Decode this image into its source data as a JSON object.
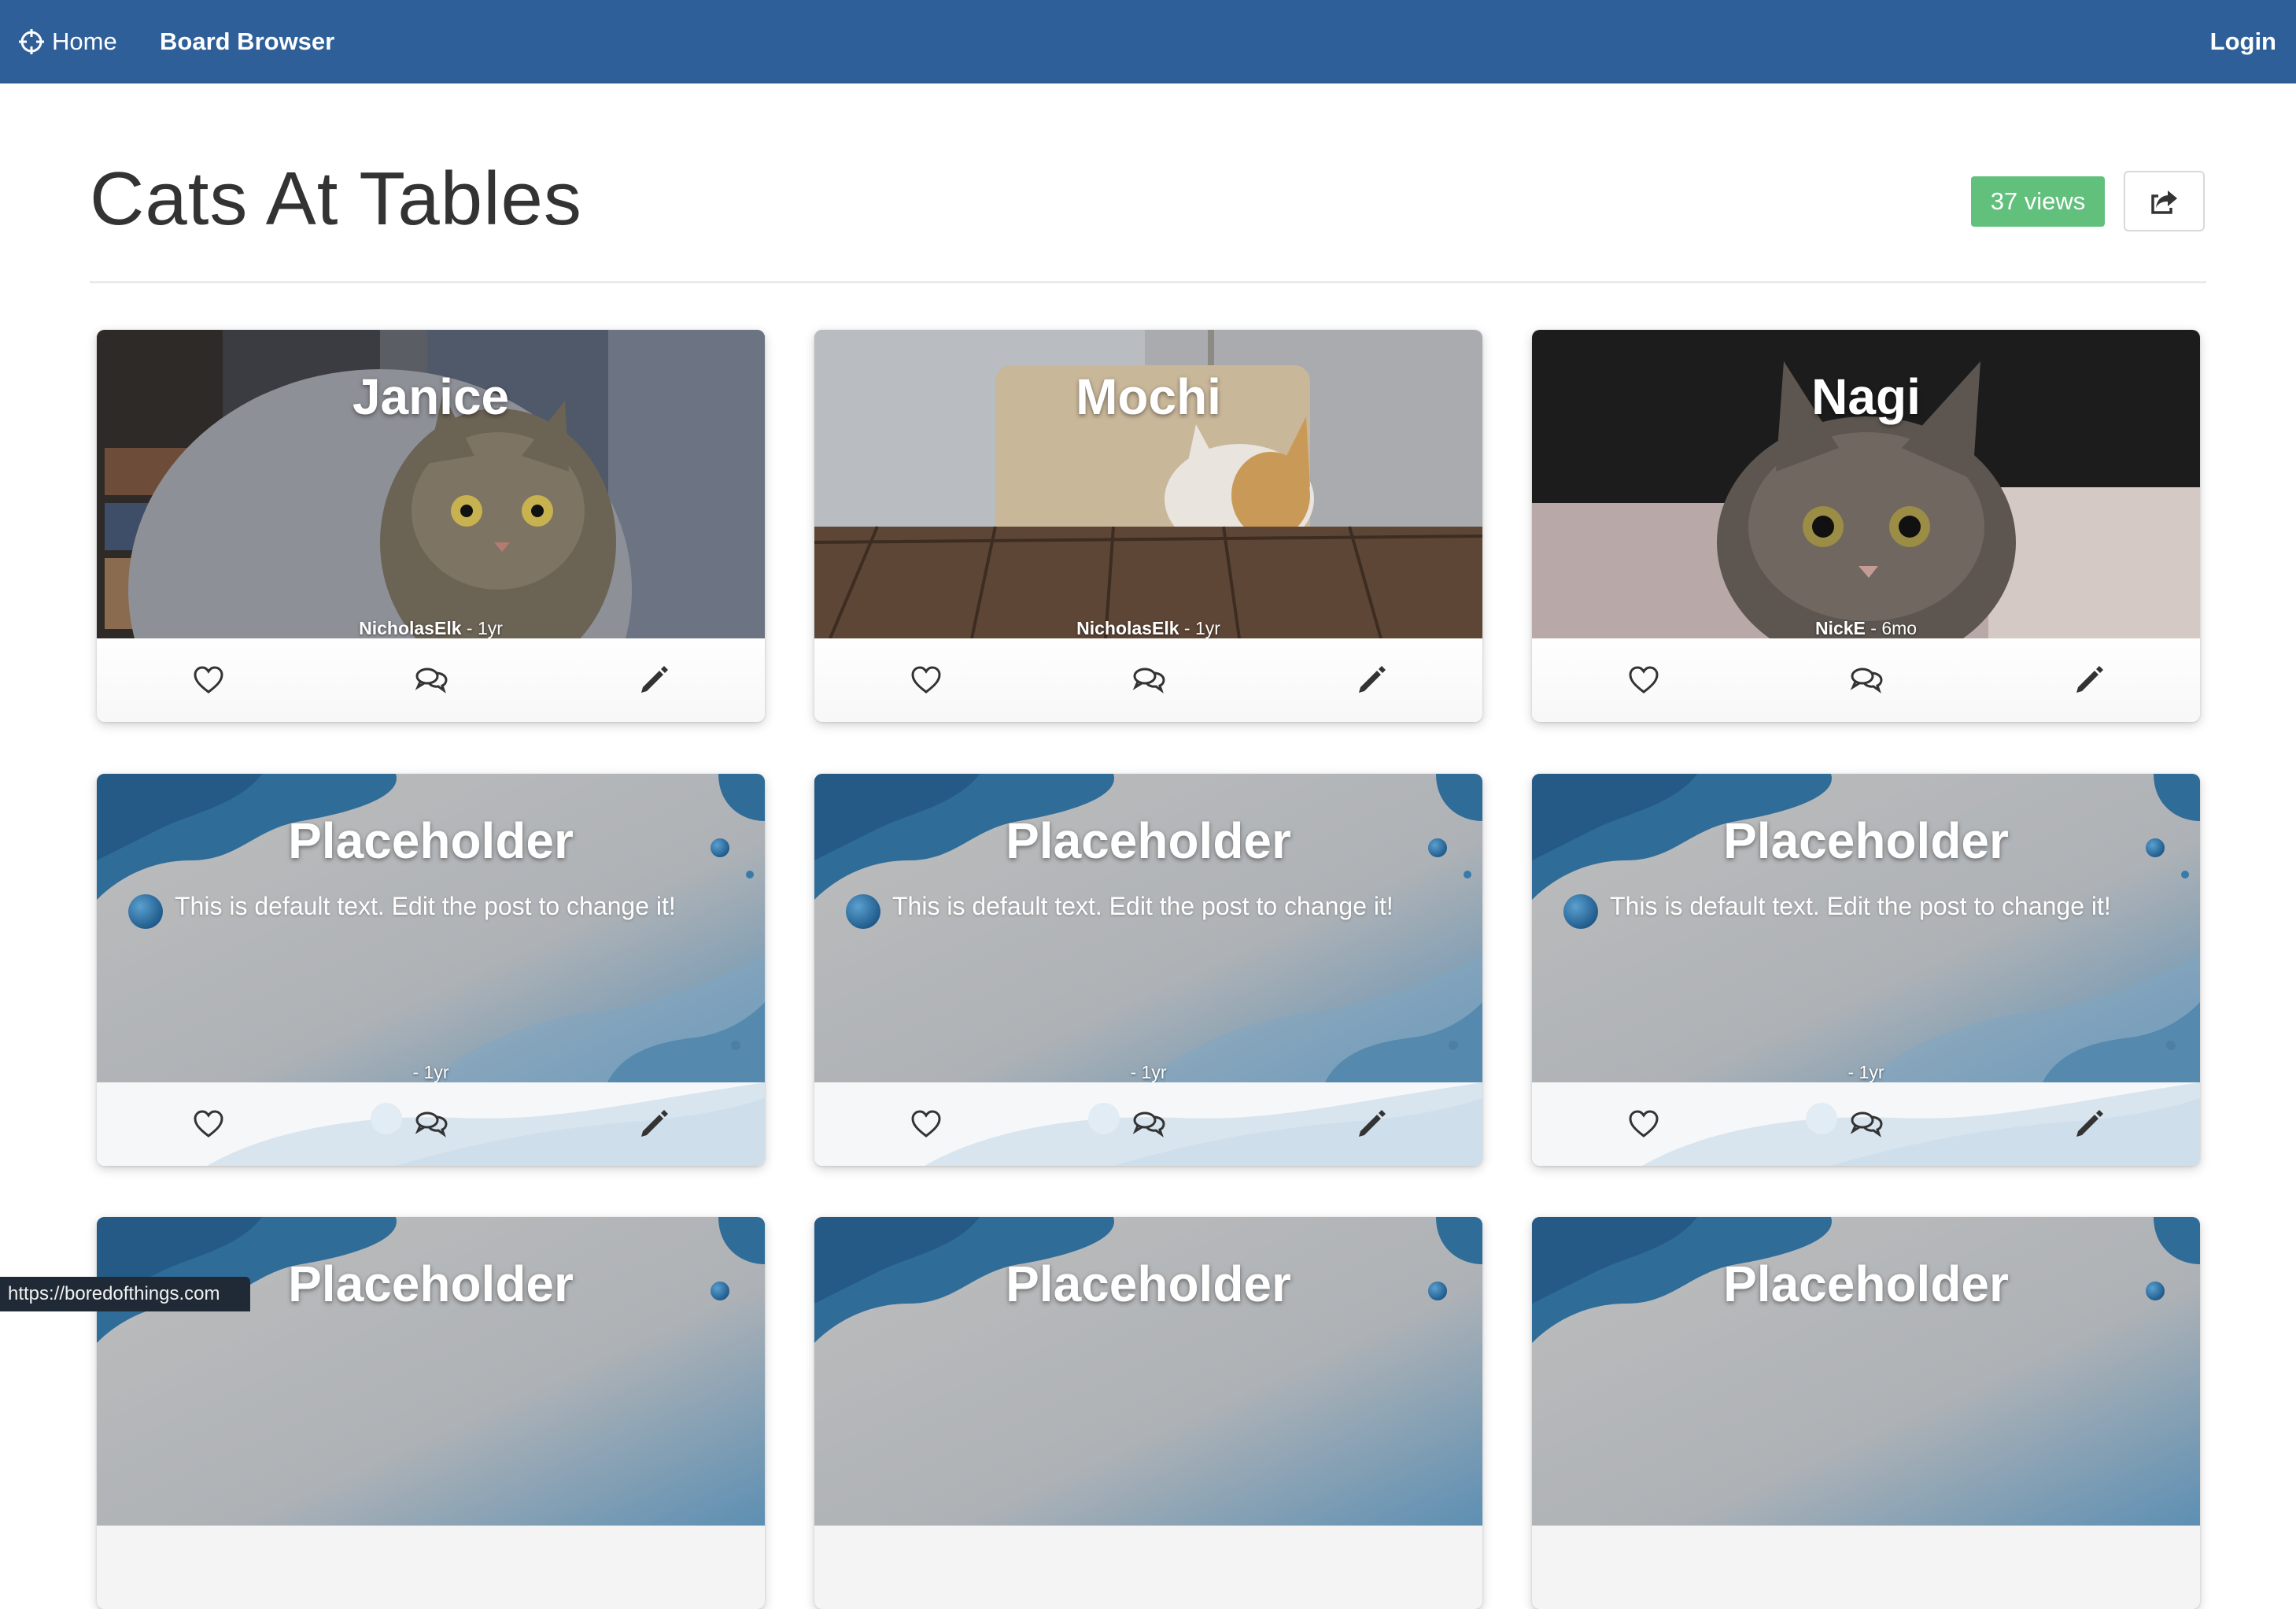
{
  "navbar": {
    "home_label": "Home",
    "browser_label": "Board Browser",
    "login_label": "Login"
  },
  "header": {
    "title": "Cats At Tables",
    "views": "37 views"
  },
  "cards": [
    {
      "title": "Janice",
      "author": "NicholasElk",
      "age": " - 1yr",
      "image": "cat-photo-janice"
    },
    {
      "title": "Mochi",
      "author": "NicholasElk",
      "age": " - 1yr",
      "image": "cat-photo-mochi"
    },
    {
      "title": "Nagi",
      "author": "NickE",
      "age": " - 6mo",
      "image": "cat-photo-nagi"
    },
    {
      "title": "Placeholder",
      "body": "This is default text. Edit the post to change it!",
      "meta": "- 1yr"
    },
    {
      "title": "Placeholder",
      "body": "This is default text. Edit the post to change it!",
      "meta": "- 1yr"
    },
    {
      "title": "Placeholder",
      "body": "This is default text. Edit the post to change it!",
      "meta": "- 1yr"
    },
    {
      "title": "Placeholder"
    },
    {
      "title": "Placeholder"
    },
    {
      "title": "Placeholder"
    }
  ],
  "actions": {
    "like_icon": "heart-outline-icon",
    "comment_icon": "comments-icon",
    "edit_icon": "pencil-icon"
  },
  "colors": {
    "navbar": "#2e5f98",
    "views_badge": "#62c07d",
    "placeholder_blue": "#2f6c98"
  },
  "status": {
    "url": "https://boredofthings.com"
  }
}
